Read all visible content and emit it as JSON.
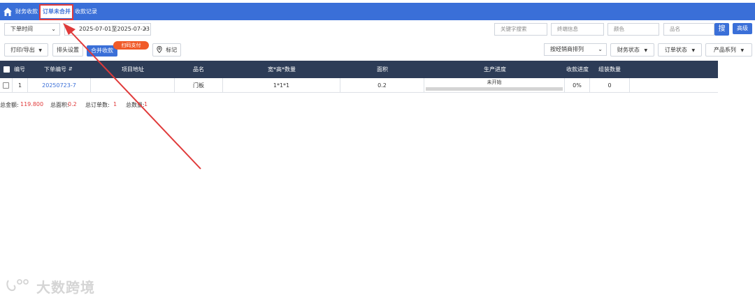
{
  "nav": {
    "tabs": [
      {
        "label": "财务收款"
      },
      {
        "label": "订单未合并"
      },
      {
        "label": "收款记录"
      }
    ],
    "active_index": 1
  },
  "filters": {
    "time_type": "下单时间",
    "date_range": "2025-07-01至2025-07-23",
    "keyword_placeholder": "关键字搜索",
    "dealer_placeholder": "终端信息",
    "color_placeholder": "颜色",
    "product_placeholder": "品名",
    "search_label": "搜",
    "advanced_label": "高级"
  },
  "toolbar": {
    "print_label": "打印/导出",
    "columns_label": "排头设置",
    "merge_label": "合并收款",
    "badge_label": "扫码支付",
    "mark_label": "标记",
    "sort_label": "按经销商排列",
    "finance_status_label": "财务状态",
    "order_status_label": "订单状态",
    "product_series_label": "产品系列"
  },
  "table": {
    "headers": {
      "index": "编号",
      "order_no": "下单编号",
      "address": "项目地址",
      "product": "品名",
      "size_qty": "宽*高*数量",
      "area": "面积",
      "progress": "生产进度",
      "payment_progress": "收款进度",
      "assembly_qty": "组装数量"
    },
    "rows": [
      {
        "index": "1",
        "order_no": "20250723-7",
        "address": "",
        "product": "门板",
        "size_qty": "1*1*1",
        "area": "0.2",
        "progress_label": "未开始",
        "progress_fraction": 0,
        "payment_progress": "0%",
        "assembly_qty": "0"
      }
    ]
  },
  "summary": {
    "amount_label": "总金额:",
    "amount_value": "119.800",
    "area_label": "总面积:",
    "area_value": "0.2",
    "orders_label": "总订单数:",
    "orders_value": "1",
    "qty_label": "总数量:",
    "qty_value": "1"
  },
  "watermark": {
    "text": "大数跨境"
  },
  "colors": {
    "accent": "#3a6fd8",
    "header_bg": "#2d3c57",
    "highlight": "#e03a3a",
    "badge": "#f05a28"
  }
}
